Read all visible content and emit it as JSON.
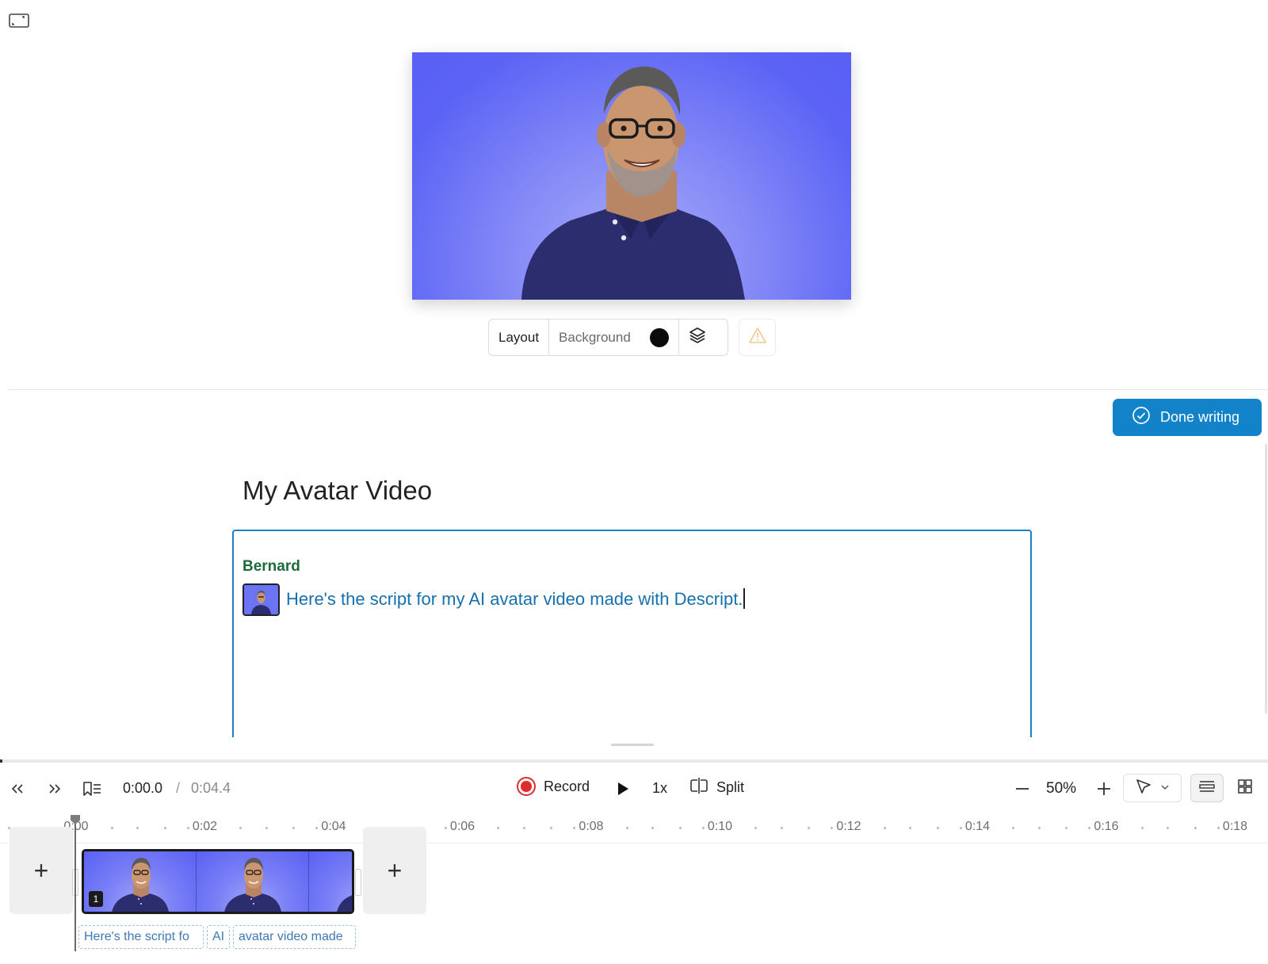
{
  "app": {
    "icons": {
      "expand": "expand-icon",
      "layers": "layers-icon",
      "warning": "warning-icon",
      "done": "check-circle-icon"
    }
  },
  "preview": {
    "image": "AI avatar of a smiling man with glasses and a navy polo shirt on a blue-purple background"
  },
  "scene_toolbar": {
    "layout_label": "Layout",
    "background_label": "Background",
    "background_color": "#0b0b0b"
  },
  "editor": {
    "done_button_label": "Done writing",
    "title": "My Avatar Video",
    "speaker": "Bernard",
    "script_text": "Here's the script for my AI avatar video made with Descript."
  },
  "transport": {
    "current_time": "0:00.0",
    "separator": "/",
    "total_time": "0:04.4",
    "record_label": "Record",
    "speed_label": "1x",
    "split_label": "Split",
    "zoom_label": "50%"
  },
  "timeline": {
    "ruler_labels": [
      "0:00",
      "0:02",
      "0:04",
      "0:06",
      "0:08",
      "0:10",
      "0:12",
      "0:14",
      "0:16",
      "0:18"
    ],
    "clip_badge": "1",
    "add_label": "+",
    "word_chips": [
      "Here's the script fo",
      "AI",
      "avatar video made"
    ]
  },
  "colors": {
    "accent": "#1283c9",
    "speaker": "#1d6a3b",
    "script_text": "#1670ad",
    "record": "#e02b2b",
    "preview_bg": "#5b63f5"
  }
}
